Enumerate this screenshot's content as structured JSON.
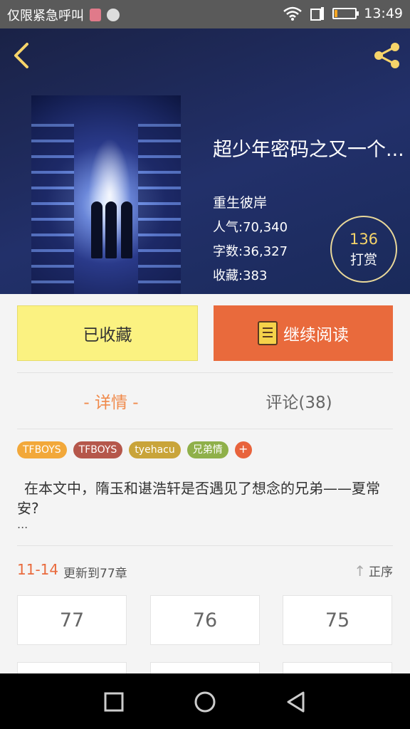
{
  "status_bar": {
    "carrier_text": "仅限紧急呼叫",
    "time": "13:49",
    "battery_level": 0.15,
    "icons": [
      "sim-icon",
      "do-not-disturb-icon",
      "wifi-icon",
      "signal-icon",
      "battery-icon"
    ]
  },
  "header": {
    "back_icon": "chevron-left-icon",
    "share_icon": "share-icon",
    "accent_color": "#f6d46a"
  },
  "book": {
    "title": "超少年密码之又一个...",
    "author": "重生彼岸",
    "popularity_label": "人气:",
    "popularity_value": "70,340",
    "words_label": "字数:",
    "words_value": "36,327",
    "favorites_label": "收藏:",
    "favorites_value": "383"
  },
  "reward": {
    "count": "136",
    "label": "打赏"
  },
  "actions": {
    "favorited_label": "已收藏",
    "continue_label": "继续阅读",
    "continue_color": "#e96a3c",
    "favorited_color": "#fbf281"
  },
  "tabs": {
    "details": "- 详情 -",
    "comments": "评论(38)"
  },
  "tags": [
    {
      "label": "TFBOYS",
      "color": "#f2a83a"
    },
    {
      "label": "TFBOYS",
      "color": "#b5574b"
    },
    {
      "label": "tyehacu",
      "color": "#c9a43a"
    },
    {
      "label": "兄弟情",
      "color": "#8fb04a"
    }
  ],
  "tag_add_label": "+",
  "synopsis": {
    "text": "在本文中，隋玉和谌浩轩是否遇见了想念的兄弟——夏常安?",
    "more": "..."
  },
  "updates": {
    "date": "11-14",
    "text": "更新到77章",
    "sort_label": "正序"
  },
  "chapters": [
    "77",
    "76",
    "75",
    "",
    "",
    ""
  ],
  "nav": {
    "buttons": [
      "recent-apps-icon",
      "home-icon",
      "back-triangle-icon"
    ]
  }
}
